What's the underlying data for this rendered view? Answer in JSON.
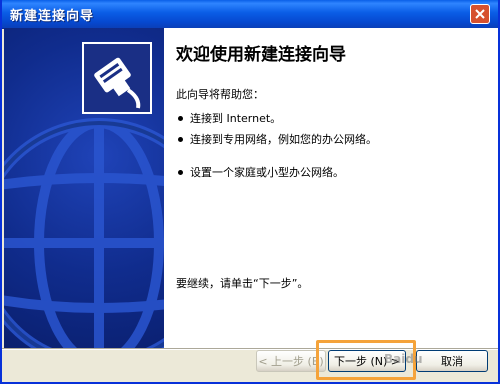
{
  "window": {
    "title": "新建连接向导"
  },
  "content": {
    "heading": "欢迎使用新建连接向导",
    "intro": "此向导将帮助您：",
    "bullets": [
      "连接到 Internet。",
      "连接到专用网络，例如您的办公网络。",
      "设置一个家庭或小型办公网络。"
    ],
    "continue_text": "要继续，请单击“下一步”。"
  },
  "buttons": {
    "back": "< 上一步 (B)",
    "next": "下一步 (N) >",
    "cancel": "取消"
  },
  "watermark": "Baidu",
  "colors": {
    "titlebar": "#0a5de6",
    "banner": "#102c8d",
    "highlight": "#f5a33a"
  },
  "icons": {
    "banner_icon": "network-cable-icon",
    "close": "close-icon"
  }
}
